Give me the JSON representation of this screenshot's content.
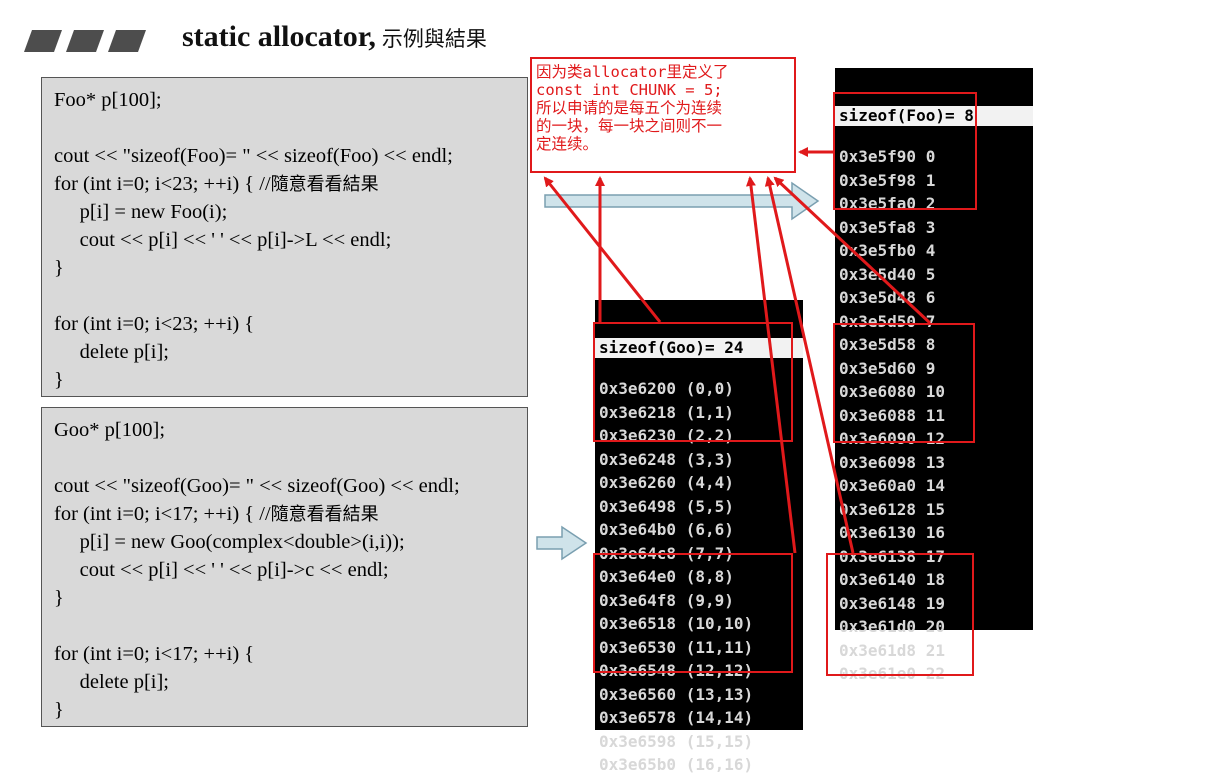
{
  "title": {
    "main": "static allocator,",
    "sub": "示例與結果"
  },
  "foo_code": [
    "Foo* p[100];",
    "",
    "cout << \"sizeof(Foo)= \" << sizeof(Foo) << endl;",
    "for (int i=0; i<23; ++i) { //隨意看看結果",
    "     p[i] = new Foo(i);",
    "     cout << p[i] << ' ' << p[i]->L << endl;",
    "}",
    "",
    "for (int i=0; i<23; ++i) {",
    "     delete p[i];",
    "}"
  ],
  "goo_code": [
    "Goo* p[100];",
    "",
    "cout << \"sizeof(Goo)= \" << sizeof(Goo) << endl;",
    "for (int i=0; i<17; ++i) { //隨意看看結果",
    "     p[i] = new Goo(complex<double>(i,i));",
    "     cout << p[i] << ' ' << p[i]->c << endl;",
    "}",
    "",
    "for (int i=0; i<17; ++i) {",
    "     delete p[i];",
    "}"
  ],
  "note": [
    "因为类allocator里定义了",
    "const int CHUNK = 5;",
    "所以申请的是每五个为连续",
    "的一块，每一块之间则不一",
    "定连续。"
  ],
  "foo_console": {
    "header": "sizeof(Foo)= 8",
    "rows": [
      "0x3e5f90 0",
      "0x3e5f98 1",
      "0x3e5fa0 2",
      "0x3e5fa8 3",
      "0x3e5fb0 4",
      "0x3e5d40 5",
      "0x3e5d48 6",
      "0x3e5d50 7",
      "0x3e5d58 8",
      "0x3e5d60 9",
      "0x3e6080 10",
      "0x3e6088 11",
      "0x3e6090 12",
      "0x3e6098 13",
      "0x3e60a0 14",
      "0x3e6128 15",
      "0x3e6130 16",
      "0x3e6138 17",
      "0x3e6140 18",
      "0x3e6148 19",
      "0x3e61d0 20",
      "0x3e61d8 21",
      "0x3e61e0 22"
    ]
  },
  "goo_console": {
    "header": "sizeof(Goo)= 24",
    "rows": [
      "0x3e6200 (0,0)",
      "0x3e6218 (1,1)",
      "0x3e6230 (2,2)",
      "0x3e6248 (3,3)",
      "0x3e6260 (4,4)",
      "0x3e6498 (5,5)",
      "0x3e64b0 (6,6)",
      "0x3e64c8 (7,7)",
      "0x3e64e0 (8,8)",
      "0x3e64f8 (9,9)",
      "0x3e6518 (10,10)",
      "0x3e6530 (11,11)",
      "0x3e6548 (12,12)",
      "0x3e6560 (13,13)",
      "0x3e6578 (14,14)",
      "0x3e6598 (15,15)",
      "0x3e65b0 (16,16)"
    ]
  },
  "colors": {
    "highlight": "#e0191b",
    "arrow_fill": "#cfe3ea",
    "arrow_stroke": "#7a9fb0",
    "code_bg": "#d9d9d9",
    "slash": "#4d4d4d"
  }
}
